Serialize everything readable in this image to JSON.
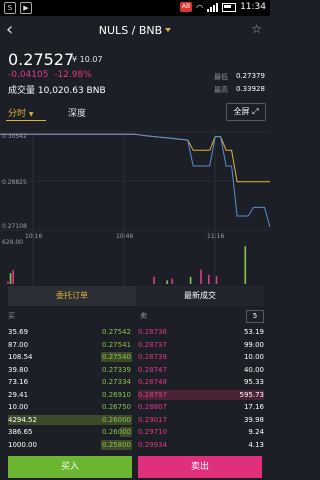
{
  "statusbar": {
    "time": "11:34",
    "battery_badge": "AB"
  },
  "header": {
    "title": "NULS / BNB"
  },
  "summary": {
    "price": "0.27527",
    "price_cny": "¥ 10.07",
    "change": "-0.04105",
    "change_pct": "-12.98%",
    "volume_label": "成交量",
    "volume": "10,020.63 BNB",
    "low_label": "最低",
    "low": "0.27379",
    "high_label": "最高",
    "high": "0.33928"
  },
  "tabs": {
    "time": "分时",
    "depth": "深度",
    "fullscreen": "全屏"
  },
  "chart_data": {
    "type": "line",
    "x_ticks": [
      "10:16",
      "10:46",
      "11:16"
    ],
    "y_ticks": [
      "0.30542",
      "0.28825",
      "0.27108"
    ],
    "volume_max_label": "629.00",
    "series": [
      {
        "values": [
          0.3046,
          0.3046,
          0.3046,
          0.3046,
          0.3046,
          0.3046,
          0.3046,
          0.3045,
          0.3042,
          0.304,
          0.3038,
          0.3036,
          0.3034,
          0.3032,
          0.303,
          0.3028,
          0.3026,
          0.299,
          0.299,
          0.299,
          0.299,
          0.3038,
          0.3038,
          0.299,
          0.299,
          0.288,
          0.288,
          0.288,
          0.288,
          0.288,
          0.288,
          0.288
        ]
      },
      {
        "values": [
          0.3046,
          0.3046,
          0.3046,
          0.3046,
          0.3046,
          0.3046,
          0.3046,
          0.3045,
          0.3042,
          0.304,
          0.3038,
          0.3036,
          0.3034,
          0.3032,
          0.303,
          0.3028,
          0.3026,
          0.2935,
          0.2935,
          0.2935,
          0.2935,
          0.3038,
          0.3038,
          0.2935,
          0.2935,
          0.276,
          0.276,
          0.276,
          0.279,
          0.279,
          0.279,
          0.272
        ]
      }
    ],
    "volume": [
      0,
      0,
      40,
      180,
      230,
      0,
      0,
      0,
      0,
      0,
      0,
      0,
      0,
      0,
      0,
      0,
      0,
      0,
      0,
      0,
      0,
      0,
      0,
      0,
      0,
      0,
      0,
      0,
      0,
      0,
      0,
      0,
      0,
      0,
      0,
      0,
      0,
      0,
      0,
      0,
      0,
      0,
      0,
      0,
      0,
      0,
      0,
      0,
      0,
      0,
      0,
      0,
      0,
      0,
      0,
      0,
      0,
      0,
      120,
      0,
      0,
      0,
      0,
      60,
      0,
      90,
      0,
      0,
      0,
      0,
      0,
      0,
      120,
      0,
      0,
      0,
      240,
      0,
      0,
      150,
      0,
      0,
      130,
      0,
      0,
      0,
      0,
      0,
      0,
      0,
      0,
      0,
      0,
      629,
      0,
      0,
      0,
      0,
      0,
      0,
      0,
      0
    ]
  },
  "orderbook": {
    "tab_orders": "委托订单",
    "tab_trades": "最新成交",
    "buy_header": "买",
    "sell_header": "卖",
    "depth": "5",
    "rows": [
      {
        "bq": "35.69",
        "bp": "0.27542",
        "sp": "0.28736",
        "sq": "53.19",
        "bbar": 0.0,
        "sbar": 0.0
      },
      {
        "bq": "87.00",
        "bp": "0.27541",
        "sp": "0.28737",
        "sq": "99.00",
        "bbar": 0.0,
        "sbar": 0.0
      },
      {
        "bq": "108.54",
        "bp": "0.27540",
        "sp": "0.28739",
        "sq": "10.00",
        "bbar": 0.25,
        "sbar": 0.0
      },
      {
        "bq": "39.80",
        "bp": "0.27339",
        "sp": "0.28747",
        "sq": "40.00",
        "bbar": 0.0,
        "sbar": 0.0
      },
      {
        "bq": "73.16",
        "bp": "0.27334",
        "sp": "0.28748",
        "sq": "95.33",
        "bbar": 0.0,
        "sbar": 0.0
      },
      {
        "bq": "29.41",
        "bp": "0.26910",
        "sp": "0.28797",
        "sq": "595.73",
        "bbar": 0.0,
        "sbar": 1.0
      },
      {
        "bq": "10.00",
        "bp": "0.26750",
        "sp": "0.28807",
        "sq": "17.16",
        "bbar": 0.0,
        "sbar": 0.0
      },
      {
        "bq": "4294.52",
        "bp": "0.26000",
        "sp": "0.29017",
        "sq": "39.98",
        "bbar": 1.0,
        "sbar": 0.0
      },
      {
        "bq": "386.65",
        "bp": "0.26000",
        "sp": "0.29710",
        "sq": "9.24",
        "bbar": 0.1,
        "sbar": 0.0
      },
      {
        "bq": "1000.00",
        "bp": "0.25800",
        "sp": "0.29934",
        "sq": "4.13",
        "bbar": 0.25,
        "sbar": 0.0
      }
    ]
  },
  "actions": {
    "buy": "买入",
    "sell": "卖出"
  }
}
